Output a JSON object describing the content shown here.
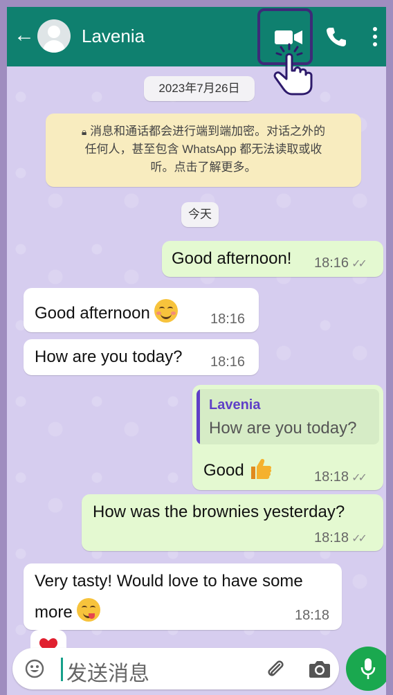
{
  "header": {
    "contact_name": "Lavenia",
    "icons": [
      "back-arrow-icon",
      "video-call-icon",
      "phone-icon",
      "more-menu-icon"
    ]
  },
  "chat": {
    "date_label": "2023年7月26日",
    "encryption_notice": {
      "line1": "消息和通话都会进行端到端加密。对话之外的",
      "line2": "任何人，甚至包含 WhatsApp 都无法读取或收",
      "line3": "听。点击了解更多。"
    },
    "today_label": "今天",
    "messages": [
      {
        "direction": "outgoing",
        "text": "Good afternoon!",
        "time": "18:16",
        "status": "read"
      },
      {
        "direction": "incoming",
        "text": "Good afternoon",
        "emoji": "smiling-face-icon",
        "time": "18:16"
      },
      {
        "direction": "incoming",
        "text": "How are you today?",
        "time": "18:16"
      },
      {
        "direction": "outgoing",
        "quote": {
          "author": "Lavenia",
          "text": "How are you today?"
        },
        "text": "Good",
        "emoji": "thumbs-up-icon",
        "time": "18:18",
        "status": "read"
      },
      {
        "direction": "outgoing",
        "text": "How was the brownies yesterday?",
        "time": "18:18",
        "status": "read"
      },
      {
        "direction": "incoming",
        "text_line1": "Very tasty! Would love to have some",
        "text_line2": "more",
        "emoji": "yum-face-icon",
        "time": "18:18"
      },
      {
        "direction": "incoming",
        "emoji": "heart-icon"
      }
    ]
  },
  "composer": {
    "placeholder": "发送消息"
  },
  "colors": {
    "header": "#0f806f",
    "outgoing_bubble": "#e4f9d1",
    "incoming_bubble": "#ffffff",
    "mic_button": "#1aa84f",
    "highlight_box": "#3d2a78"
  }
}
